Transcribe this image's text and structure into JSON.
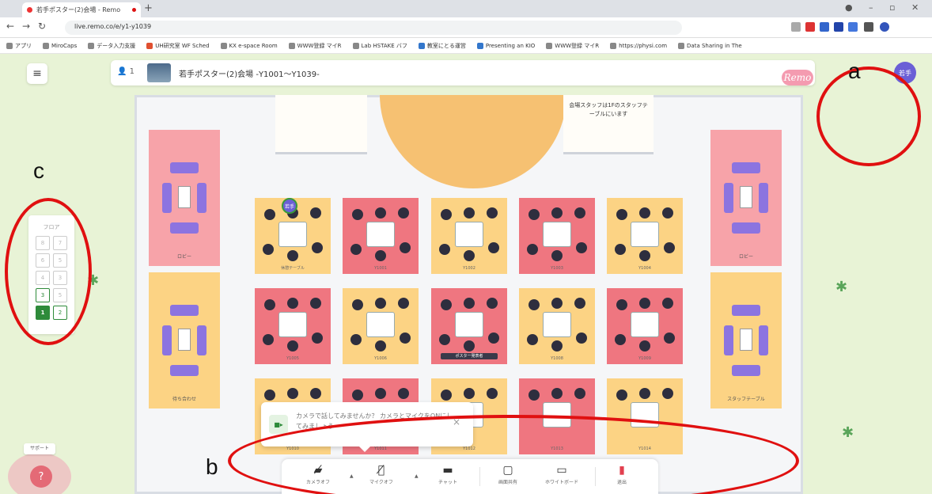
{
  "browser": {
    "tab_title": "若手ポスター(2)会場 - Remo",
    "url": "live.remo.co/e/y1-y1039",
    "bookmarks": [
      "アプリ",
      "MiroCaps",
      "データ入力支援",
      "UH研究室 WF Sched",
      "KX e-space Room",
      "WWW登録 マイR",
      "Lab HSTAKE バフ",
      "教室にとる運営",
      "Presenting an KIO",
      "WWW登録 マイR",
      "https://physi.com",
      "Data Sharing in The"
    ]
  },
  "header": {
    "menu_icon": "hamburger-icon",
    "participants": "1",
    "room_title": "若手ポスター(2)会場 -Y1001～Y1039-",
    "logo": "Remo",
    "avatar_initials": "若手"
  },
  "stage": {
    "poster_right": "会場スタッフは1Fのスタッフテーブルにいます"
  },
  "floor_selector": {
    "heading": "フロア",
    "floors": [
      "8",
      "7",
      "6",
      "5",
      "4",
      "3",
      "2",
      "1"
    ],
    "stroked": [
      "3",
      "2"
    ],
    "active": "1"
  },
  "tables": {
    "labels": [
      "休憩テーブル",
      "Y1001",
      "Y1002",
      "Y1003",
      "Y1004",
      "Y1005",
      "Y1006",
      "Y1007",
      "Y1008",
      "Y1009",
      "Y1010",
      "Y1011",
      "Y1012",
      "Y1013",
      "Y1014"
    ],
    "tag_label": "ポスター発表者",
    "guest_avatar": "若手"
  },
  "side_rooms": {
    "left_top": "ロビー",
    "left_bottom": "待ち合わせ",
    "right_top": "ロビー",
    "right_bottom": "スタッフテーブル"
  },
  "toast": {
    "message": "カメラで話してみませんか？ カメラとマイクをONにしてみましょう",
    "close": "×"
  },
  "toolbar": {
    "camera": "カメラオフ",
    "mic": "マイクオフ",
    "chat": "チャット",
    "share": "画面共有",
    "whiteboard": "ホワイトボード",
    "leave": "退出"
  },
  "support": {
    "label": "サポート",
    "icon": "?"
  },
  "annotations": {
    "a": "a",
    "b": "b",
    "c": "c"
  }
}
